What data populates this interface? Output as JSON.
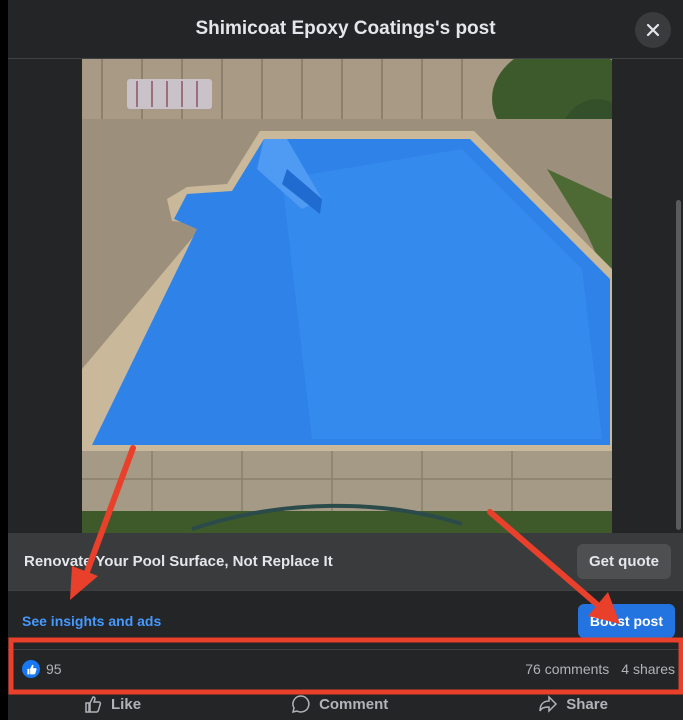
{
  "header": {
    "title": "Shimicoat Epoxy Coatings's post"
  },
  "cta": {
    "headline": "Renovate Your Pool Surface, Not Replace It",
    "button_label": "Get quote"
  },
  "insights": {
    "link_label": "See insights and ads",
    "boost_label": "Boost post"
  },
  "stats": {
    "reactions_count": "95",
    "comments": "76 comments",
    "shares": "4 shares"
  },
  "actions": {
    "like": "Like",
    "comment": "Comment",
    "share": "Share"
  },
  "colors": {
    "accent": "#2374e1",
    "link": "#4599ff",
    "annotation": "#e8402a",
    "pool": "#2f83e8"
  },
  "icons": {
    "close": "close-icon",
    "like": "thumbs-up-icon",
    "comment": "comment-icon",
    "share": "share-icon"
  }
}
